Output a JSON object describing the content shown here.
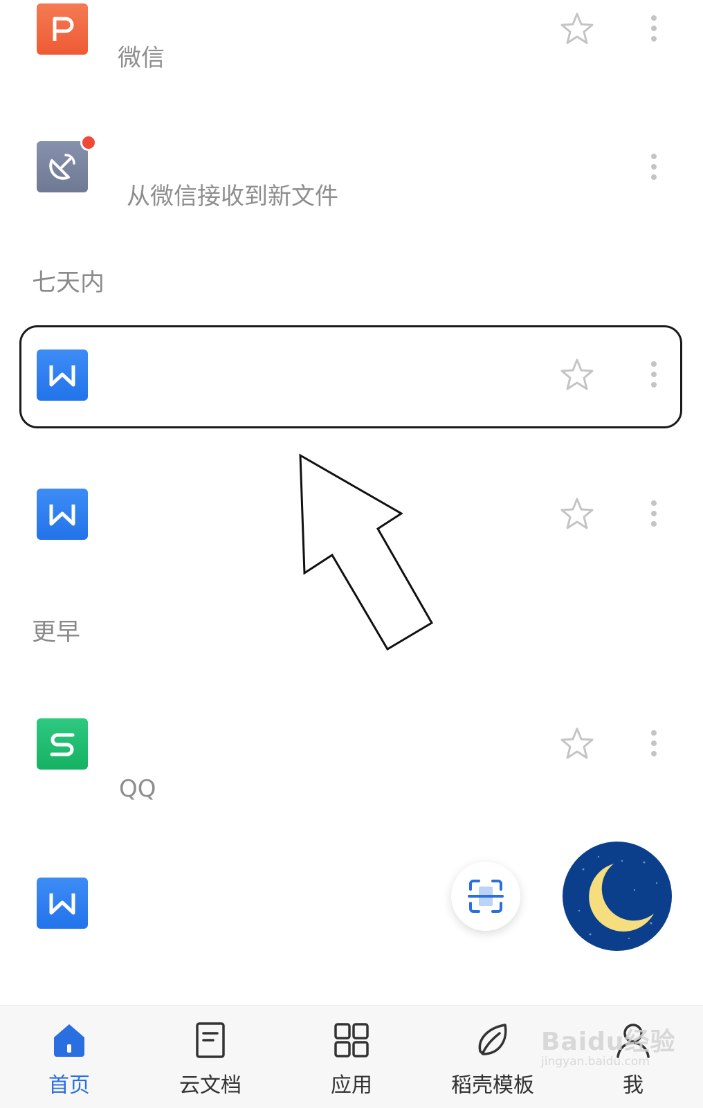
{
  "files": [
    {
      "type": "ppt",
      "subtitle": "微信",
      "starred_visible": true
    },
    {
      "type": "transfer",
      "subtitle": "从微信接收到新文件",
      "starred_visible": false,
      "notification_dot": true
    },
    {
      "type": "word",
      "subtitle": "",
      "starred_visible": true,
      "highlighted": true
    },
    {
      "type": "word",
      "subtitle": "",
      "starred_visible": true
    },
    {
      "type": "sheet",
      "subtitle": "QQ",
      "starred_visible": true
    },
    {
      "type": "word",
      "subtitle": "",
      "starred_visible": false
    }
  ],
  "sections": {
    "seven_days": "七天内",
    "earlier": "更早"
  },
  "icon_letters": {
    "ppt": "P",
    "word": "W",
    "sheet": "S"
  },
  "bottom_nav": [
    {
      "label": "首页",
      "icon": "home-icon",
      "active": true
    },
    {
      "label": "云文档",
      "icon": "document-icon",
      "active": false
    },
    {
      "label": "应用",
      "icon": "apps-grid-icon",
      "active": false
    },
    {
      "label": "稻壳模板",
      "icon": "leaf-icon",
      "active": false
    },
    {
      "label": "我",
      "icon": "person-icon",
      "active": false
    }
  ],
  "watermark": {
    "main": "Baidu经验",
    "sub": "jingyan.baidu.com"
  },
  "colors": {
    "accent": "#2a6fe0",
    "word": "#2f7ff0",
    "ppt": "#f16843",
    "sheet": "#21bd72",
    "night_fab": "#0b3f8c"
  }
}
